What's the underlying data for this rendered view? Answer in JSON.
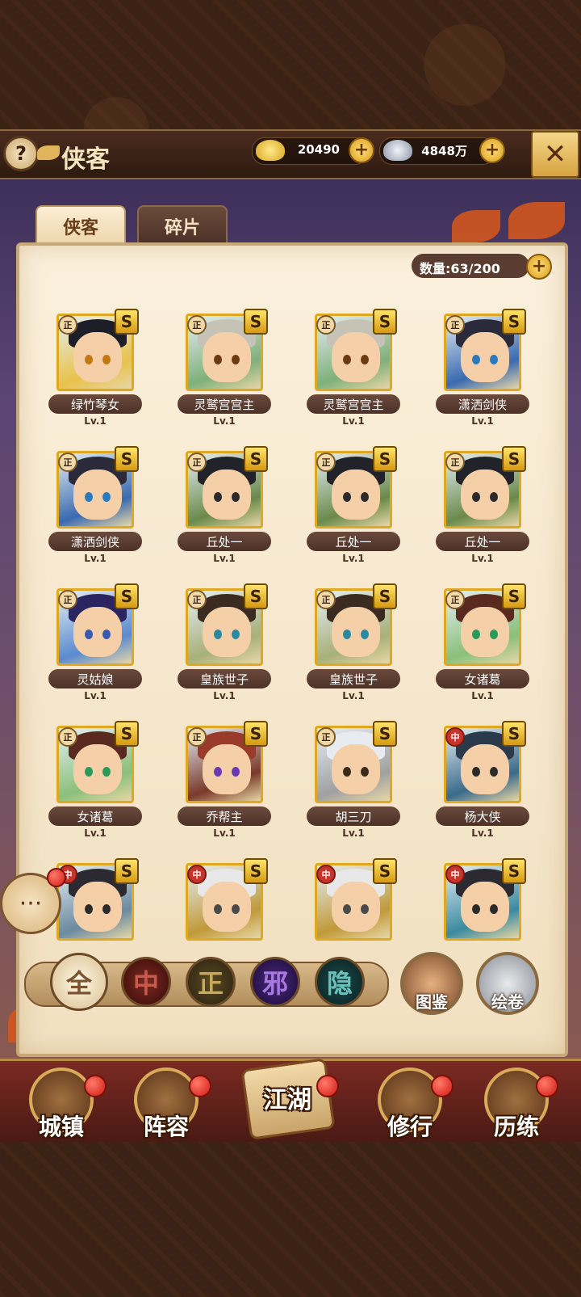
{
  "header": {
    "title": "侠客",
    "help_icon": "question-icon",
    "gold_value": "20490",
    "silver_value": "4848万",
    "close_icon": "close-icon"
  },
  "tabs": [
    {
      "label": "侠客",
      "active": true
    },
    {
      "label": "碎片",
      "active": false
    }
  ],
  "capacity": "数量:63/200",
  "cards": [
    {
      "name": "绿竹琴女",
      "level": "Lv.1",
      "faction": "正",
      "rank": "S",
      "hair": "#1e1e28",
      "accent": "#e8c24a",
      "eye": "#c27a10"
    },
    {
      "name": "灵鹫宫宫主",
      "level": "Lv.1",
      "faction": "正",
      "rank": "S",
      "hair": "#c7c2b6",
      "accent": "#7fb07a",
      "eye": "#6b3a10"
    },
    {
      "name": "灵鹫宫宫主",
      "level": "Lv.1",
      "faction": "正",
      "rank": "S",
      "hair": "#c7c2b6",
      "accent": "#7fb07a",
      "eye": "#6b3a10"
    },
    {
      "name": "潇洒剑侠",
      "level": "Lv.1",
      "faction": "正",
      "rank": "S",
      "hair": "#2a2a3a",
      "accent": "#3a6ab0",
      "eye": "#2a7ac0"
    },
    {
      "name": "潇洒剑侠",
      "level": "Lv.1",
      "faction": "正",
      "rank": "S",
      "hair": "#2a2a3a",
      "accent": "#3a6ab0",
      "eye": "#2a7ac0"
    },
    {
      "name": "丘处一",
      "level": "Lv.1",
      "faction": "正",
      "rank": "S",
      "hair": "#22222a",
      "accent": "#6a8a4a",
      "eye": "#2a2a2a"
    },
    {
      "name": "丘处一",
      "level": "Lv.1",
      "faction": "正",
      "rank": "S",
      "hair": "#22222a",
      "accent": "#6a8a4a",
      "eye": "#2a2a2a"
    },
    {
      "name": "丘处一",
      "level": "Lv.1",
      "faction": "正",
      "rank": "S",
      "hair": "#22222a",
      "accent": "#6a8a4a",
      "eye": "#2a2a2a"
    },
    {
      "name": "灵姑娘",
      "level": "Lv.1",
      "faction": "正",
      "rank": "S",
      "hair": "#2a2460",
      "accent": "#5a8ad0",
      "eye": "#3a5ab0"
    },
    {
      "name": "皇族世子",
      "level": "Lv.1",
      "faction": "正",
      "rank": "S",
      "hair": "#3a2a20",
      "accent": "#a8b07a",
      "eye": "#2a8aa0"
    },
    {
      "name": "皇族世子",
      "level": "Lv.1",
      "faction": "正",
      "rank": "S",
      "hair": "#3a2a20",
      "accent": "#a8b07a",
      "eye": "#2a8aa0"
    },
    {
      "name": "女诸葛",
      "level": "Lv.1",
      "faction": "正",
      "rank": "S",
      "hair": "#5a2a20",
      "accent": "#8ac07a",
      "eye": "#2a9a5a"
    },
    {
      "name": "女诸葛",
      "level": "Lv.1",
      "faction": "正",
      "rank": "S",
      "hair": "#5a2a20",
      "accent": "#8ac07a",
      "eye": "#2a9a5a"
    },
    {
      "name": "乔帮主",
      "level": "Lv.1",
      "faction": "正",
      "rank": "S",
      "hair": "#9a3a2a",
      "accent": "#7a3a2a",
      "eye": "#6a3ab0"
    },
    {
      "name": "胡三刀",
      "level": "Lv.1",
      "faction": "正",
      "rank": "S",
      "hair": "#e8ecf0",
      "accent": "#a0a0a0",
      "eye": "#3a2a1a"
    },
    {
      "name": "杨大侠",
      "level": "Lv.1",
      "faction": "中",
      "rank": "S",
      "hair": "#2a3a4a",
      "accent": "#3a6a8a",
      "eye": "#2a2a2a"
    },
    {
      "name": "",
      "level": "",
      "faction": "中",
      "rank": "S",
      "hair": "#2a2a30",
      "accent": "#6a8aa0",
      "eye": "#2a2a2a"
    },
    {
      "name": "",
      "level": "",
      "faction": "中",
      "rank": "S",
      "hair": "#e8e8e8",
      "accent": "#c09a3a",
      "eye": "#4a4a4a"
    },
    {
      "name": "",
      "level": "",
      "faction": "中",
      "rank": "S",
      "hair": "#e8e8e8",
      "accent": "#c09a3a",
      "eye": "#4a4a4a"
    },
    {
      "name": "",
      "level": "",
      "faction": "中",
      "rank": "S",
      "hair": "#2a2a30",
      "accent": "#3a8aa0",
      "eye": "#2a2a2a"
    }
  ],
  "filters": [
    {
      "label": "全",
      "color": "#f4e6c4",
      "text": "#7a5430"
    },
    {
      "label": "中",
      "color": "#6a1a1a",
      "text": "#b84a3a"
    },
    {
      "label": "正",
      "color": "#4a3a1a",
      "text": "#b89a4a"
    },
    {
      "label": "邪",
      "color": "#3a1a5a",
      "text": "#9a6ad0"
    },
    {
      "label": "隐",
      "color": "#1a3a3a",
      "text": "#5aa8a0"
    }
  ],
  "side_buttons": {
    "atlas": "图鉴",
    "scroll": "绘卷"
  },
  "bottom_nav": [
    {
      "label": "城镇"
    },
    {
      "label": "阵容"
    },
    {
      "label": "江湖"
    },
    {
      "label": "修行"
    },
    {
      "label": "历练"
    }
  ]
}
